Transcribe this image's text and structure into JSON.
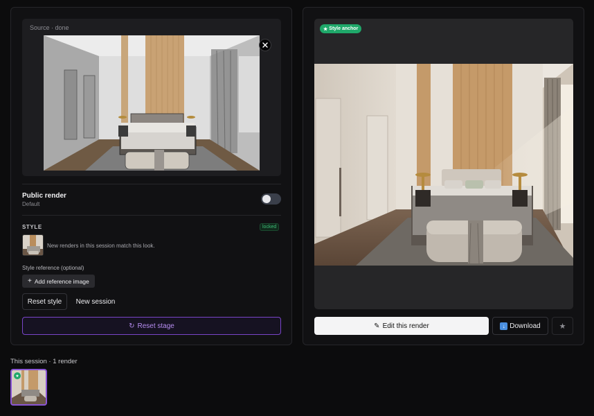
{
  "source": {
    "label": "Source · done",
    "close_icon": "close-icon"
  },
  "public_render": {
    "title": "Public render",
    "subtitle": "Default",
    "enabled": false
  },
  "style": {
    "heading": "STYLE",
    "badge": "locked",
    "note": "New renders in this session match this look.",
    "reference_label": "Style reference (optional)",
    "add_reference": "Add reference image",
    "reset_style": "Reset style",
    "new_session": "New session",
    "reset_stage": "Reset stage"
  },
  "render": {
    "anchor_badge": "Style anchor",
    "edit_button": "Edit this render",
    "download_button": "Download",
    "star_icon": "star-icon"
  },
  "session": {
    "label": "This session · 1 render"
  },
  "colors": {
    "accent_purple": "#8a55d6",
    "anchor_green": "#1fa86a",
    "background": "#0c0c0d"
  }
}
